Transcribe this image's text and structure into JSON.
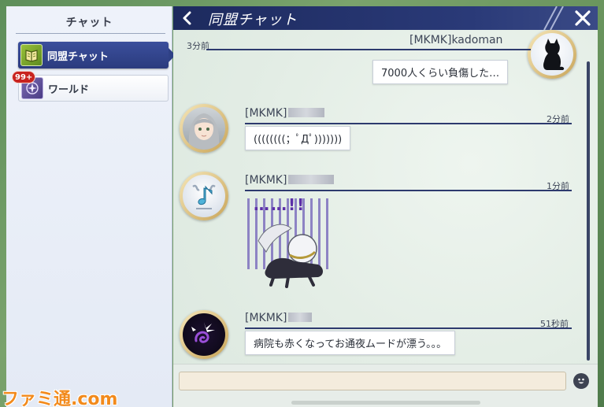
{
  "sidebar": {
    "title": "チャット",
    "tabs": [
      {
        "label": "同盟チャット",
        "icon": "alliance-book-icon",
        "selected": true
      },
      {
        "label": "ワールド",
        "icon": "world-crest-icon",
        "badge": "99+"
      }
    ]
  },
  "header": {
    "title": "同盟チャット",
    "back_icon": "chevron-left-icon",
    "close_icon": "close-icon"
  },
  "messages": [
    {
      "sender": "[MKMK]kadoman",
      "time": "3分前",
      "text": "7000人くらい負傷した…",
      "side": "right",
      "avatar": "black-cat-avatar"
    },
    {
      "sender": "[MKMK]",
      "time": "2分前",
      "text": "((((((((；ﾟДﾟ)))))))",
      "side": "left",
      "avatar": "gray-haired-girl-avatar"
    },
    {
      "sender": "[MKMK]",
      "time": "1分前",
      "text": "",
      "side": "left",
      "avatar": "music-note-avatar",
      "sticker": "crawling-character-sticker",
      "sticker_text": "……!!"
    },
    {
      "sender": "[MKMK]",
      "time": "51秒前",
      "text": "病院も赤くなってお通夜ムードが漂う。。。",
      "side": "left",
      "avatar": "purple-swirl-avatar"
    }
  ],
  "input": {
    "value": "",
    "placeholder": ""
  },
  "watermark": "ファミ通.com",
  "colors": {
    "header": "#1d2a5e",
    "selected_tab": "#2b3b7e",
    "badge": "#c8231f",
    "avatar_ring": "#c9a559",
    "panel_bg": "#e4eee7"
  }
}
